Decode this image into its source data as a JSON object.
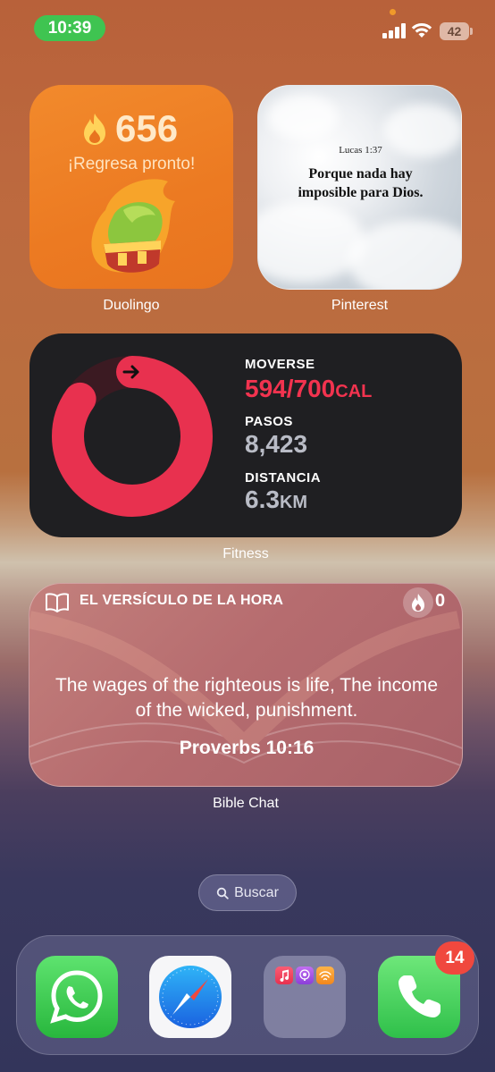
{
  "status_bar": {
    "time": "10:39",
    "battery": "42"
  },
  "widgets": {
    "duolingo": {
      "streak": "656",
      "subtitle": "¡Regresa pronto!",
      "label": "Duolingo"
    },
    "pinterest": {
      "reference": "Lucas 1:37",
      "quote_line1": "Porque nada hay",
      "quote_line2": "imposible para Dios.",
      "label": "Pinterest"
    },
    "fitness": {
      "move_label": "MOVERSE",
      "move_value": "594/700",
      "move_unit": "CAL",
      "steps_label": "PASOS",
      "steps_value": "8,423",
      "distance_label": "DISTANCIA",
      "distance_value": "6.3",
      "distance_unit": "KM",
      "move_progress": 0.849,
      "ring_color": "#e8314f",
      "label": "Fitness"
    },
    "bible": {
      "title": "EL VERSÍCULO DE LA HORA",
      "streak": "0",
      "verse": "The wages of the righteous is life, The income of the wicked, punishment.",
      "reference": "Proverbs 10:16",
      "label": "Bible Chat"
    }
  },
  "search": {
    "label": "Buscar"
  },
  "dock": {
    "apps": [
      "whatsapp",
      "safari",
      "folder",
      "phone"
    ],
    "phone_badge": "14"
  }
}
